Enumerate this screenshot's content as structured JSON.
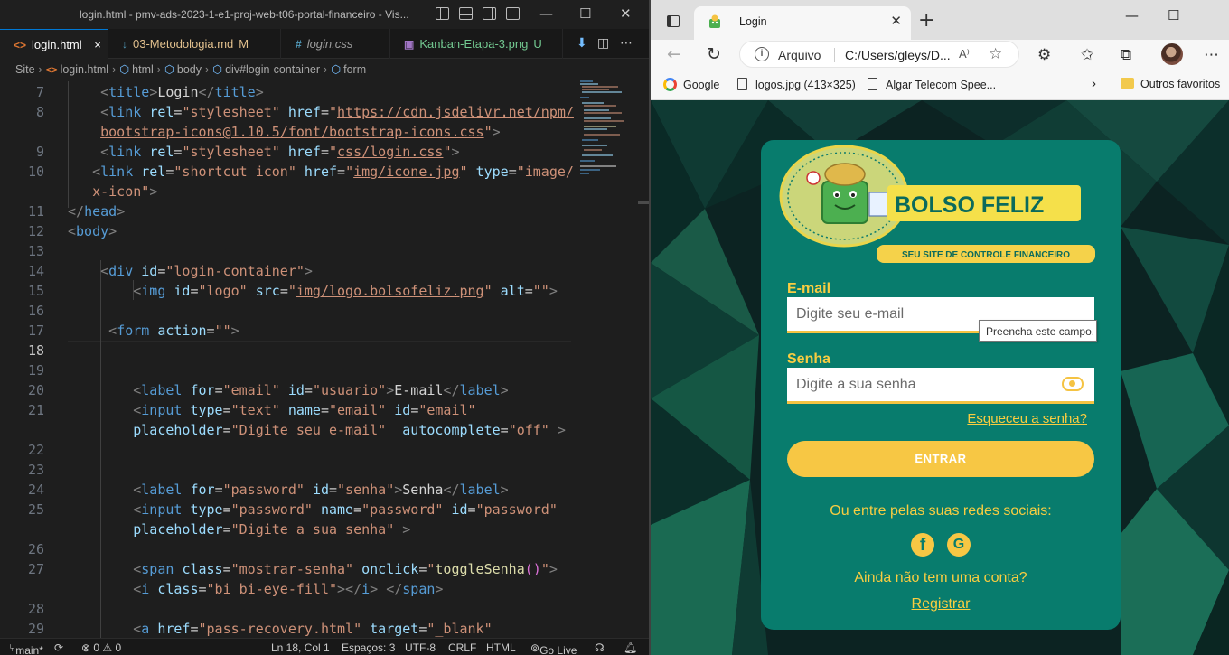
{
  "vscode": {
    "window_title": "login.html - pmv-ads-2023-1-e1-proj-web-t06-portal-financeiro - Vis...",
    "tabs": [
      {
        "icon": "<>",
        "label": "login.html",
        "close": "×",
        "active": true
      },
      {
        "icon": "↓",
        "label": "03-Metodologia.md",
        "modified": "M"
      },
      {
        "icon": "#",
        "label": "login.css"
      },
      {
        "icon": "▣",
        "label": "Kanban-Etapa-3.png",
        "modified": "U"
      }
    ],
    "breadcrumb": {
      "site": "Site",
      "file": "login.html",
      "html": "html",
      "body": "body",
      "div": "div#login-container",
      "form": "form"
    },
    "current_line": "18",
    "status": {
      "branch": "main*",
      "problems": "⊗ 0 ⚠ 0",
      "position": "Ln 18, Col 1",
      "spaces": "Espaços: 3",
      "encoding": "UTF-8",
      "eol": "CRLF",
      "language": "HTML",
      "golive": "Go Live"
    }
  },
  "browser": {
    "tab_title": "Login",
    "address_label": "Arquivo",
    "url": "C:/Users/gleys/D...",
    "reader_mode": "A⁾",
    "bookmarks": [
      "Google",
      "logos.jpg (413×325)",
      "Algar Telecom Spee..."
    ],
    "other_favorites": "Outros favoritos"
  },
  "page": {
    "logo": {
      "brand": "BOLSO FELIZ",
      "tagline": "SEU SITE DE CONTROLE FINANCEIRO"
    },
    "email_label": "E-mail",
    "email_placeholder": "Digite seu e-mail",
    "tooltip": "Preencha este campo.",
    "password_label": "Senha",
    "password_placeholder": "Digite a sua senha",
    "forgot": "Esqueceu a senha?",
    "enter": "ENTRAR",
    "social_text": "Ou entre pelas suas redes sociais:",
    "no_account": "Ainda não tem uma conta?",
    "register": "Registrar",
    "colors": {
      "card": "#087c6d",
      "accent": "#f9cd41",
      "button": "#f7c744"
    }
  }
}
